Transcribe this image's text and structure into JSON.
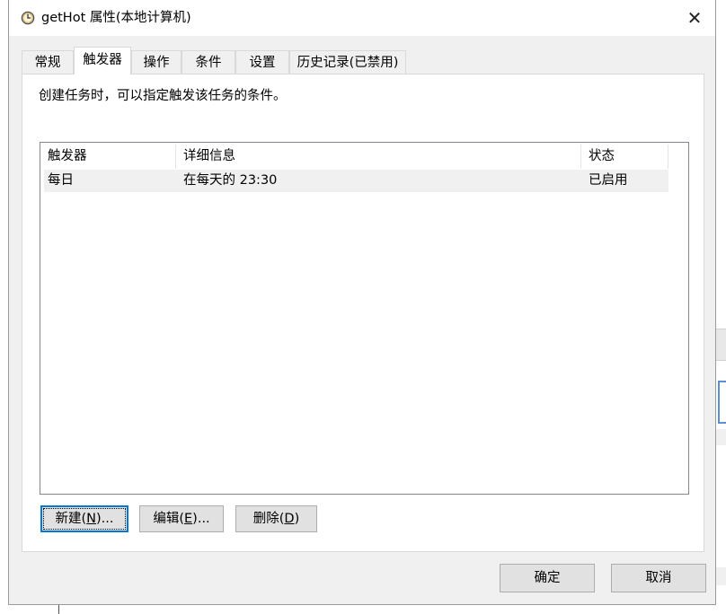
{
  "window": {
    "title": "getHot 属性(本地计算机)",
    "title_icon": "clock-icon",
    "close_glyph": "✕"
  },
  "tabs": [
    {
      "label": "常规",
      "active": false
    },
    {
      "label": "触发器",
      "active": true
    },
    {
      "label": "操作",
      "active": false
    },
    {
      "label": "条件",
      "active": false
    },
    {
      "label": "设置",
      "active": false
    },
    {
      "label": "历史记录(已禁用)",
      "active": false
    }
  ],
  "triggers_panel": {
    "description": "创建任务时，可以指定触发该任务的条件。",
    "columns": [
      "触发器",
      "详细信息",
      "状态"
    ],
    "rows": [
      {
        "trigger": "每日",
        "details": "在每天的 23:30",
        "status": "已启用"
      }
    ],
    "buttons": {
      "new": {
        "text": "新建(",
        "mnemonic": "N",
        "suffix": ")..."
      },
      "edit": {
        "text": "编辑(",
        "mnemonic": "E",
        "suffix": ")..."
      },
      "delete": {
        "text": "删除(",
        "mnemonic": "D",
        "suffix": ")"
      }
    }
  },
  "footer": {
    "ok_label": "确定",
    "cancel_label": "取消"
  },
  "colors": {
    "dialog_bg": "#f0f0f0",
    "panel_bg": "#ffffff",
    "focus_border": "#0078d7",
    "button_bg": "#e1e1e1"
  }
}
